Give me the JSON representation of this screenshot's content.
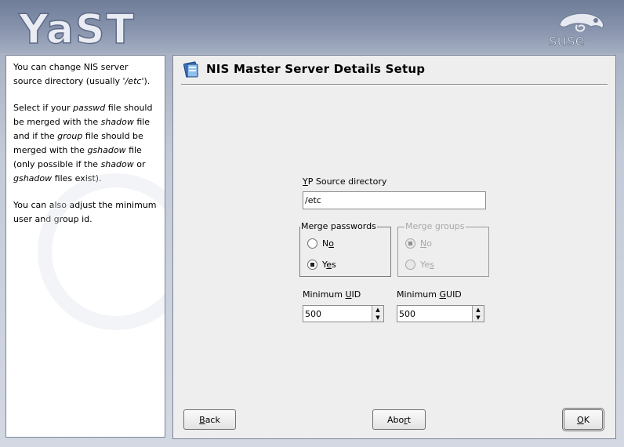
{
  "app": {
    "logo_text": "YaST",
    "vendor_logo_text": "suse"
  },
  "help": {
    "paragraphs": [
      [
        {
          "t": "You can change NIS server source directory (usually '"
        },
        {
          "t": "/etc",
          "i": true
        },
        {
          "t": "')."
        }
      ],
      [
        {
          "t": "Select if your "
        },
        {
          "t": "passwd",
          "i": true
        },
        {
          "t": " file should be merged with the "
        },
        {
          "t": "shadow",
          "i": true
        },
        {
          "t": " file and if the "
        },
        {
          "t": "group",
          "i": true
        },
        {
          "t": " file should be merged with the "
        },
        {
          "t": "gshadow",
          "i": true
        },
        {
          "t": " file (only possible if the "
        },
        {
          "t": "shadow",
          "i": true
        },
        {
          "t": " or "
        },
        {
          "t": "gshadow",
          "i": true
        },
        {
          "t": " files exist)."
        }
      ],
      [
        {
          "t": "You can also adjust the minimum user and group id."
        }
      ]
    ]
  },
  "dialog": {
    "title": "NIS Master Server Details Setup",
    "icon": "nis-server-icon",
    "yp_source": {
      "label_pre": "",
      "label_key": "Y",
      "label_post": "P Source directory",
      "value": "/etc"
    },
    "merge_passwords": {
      "label": "Merge passwords",
      "no_pre": "N",
      "no_key": "o",
      "no_post": "",
      "yes_pre": "Y",
      "yes_key": "e",
      "yes_post": "s",
      "selected": "No"
    },
    "merge_groups": {
      "label": "Merge groups",
      "no_pre": "",
      "no_key": "N",
      "no_post": "o",
      "yes_pre": "Ye",
      "yes_key": "s",
      "yes_post": "",
      "selected": "No",
      "enabled": false
    },
    "min_uid": {
      "label_pre": "Minimum ",
      "label_key": "U",
      "label_post": "ID",
      "value": "500"
    },
    "min_gid": {
      "label_pre": "Minimum ",
      "label_key": "G",
      "label_post": "UID",
      "value": "500"
    }
  },
  "buttons": {
    "back": {
      "pre": "",
      "key": "B",
      "post": "ack"
    },
    "abort": {
      "pre": "Abo",
      "key": "r",
      "post": "t"
    },
    "ok": {
      "pre": "",
      "key": "O",
      "post": "K"
    }
  }
}
